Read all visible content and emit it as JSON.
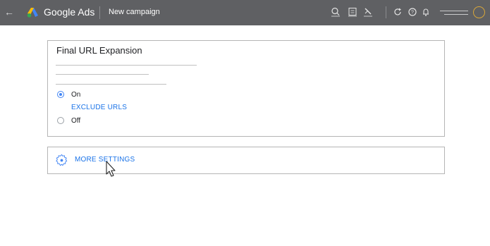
{
  "topbar": {
    "back_icon": "arrow-left",
    "logo_icon": "google-ads-logo",
    "app_name": "Google Ads",
    "page_title": "New campaign",
    "icons": [
      "search-icon",
      "reports-icon",
      "tools-icon",
      "refresh-icon",
      "help-icon",
      "notifications-icon"
    ]
  },
  "final_url": {
    "title": "Final URL Expansion",
    "options": [
      {
        "label": "On",
        "selected": true
      },
      {
        "label": "Off",
        "selected": false
      }
    ],
    "exclude_link": "EXCLUDE URLS"
  },
  "more_settings": {
    "label": "MORE SETTINGS",
    "icon": "gear-icon"
  },
  "colors": {
    "topbar": "#5f6063",
    "accent": "#1a73e8",
    "radio": "#4285f4"
  }
}
